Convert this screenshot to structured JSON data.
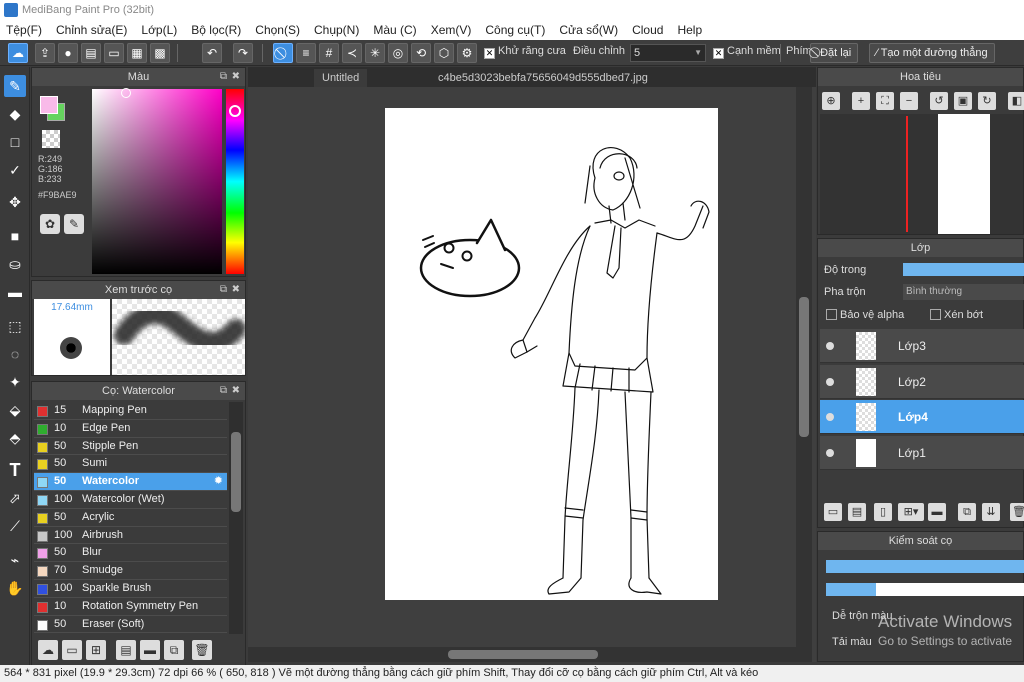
{
  "title": "MediBang Paint Pro (32bit)",
  "menu": [
    "Tệp(F)",
    "Chỉnh sửa(E)",
    "Lớp(L)",
    "Bộ lọc(R)",
    "Chọn(S)",
    "Chụp(N)",
    "Màu (C)",
    "Xem(V)",
    "Công cụ(T)",
    "Cửa sổ(W)",
    "Cloud",
    "Help"
  ],
  "toolbar": {
    "antialias_label": "Khử răng cưa",
    "adjust_label": "Điều chỉnh",
    "adjust_value": "5",
    "edge_label": "Cạnh mềm",
    "key_label": "Phím",
    "reset_label": "Đặt lại",
    "create_line_label": "Tạo một đường thẳng"
  },
  "color_panel": {
    "title": "Màu",
    "r": "R:249",
    "g": "G:186",
    "b": "B:233",
    "hex": "#F9BAE9",
    "fg_color": "#F9BAE9"
  },
  "brush_preview": {
    "title": "Xem trước cọ",
    "size": "17.64mm"
  },
  "brush_panel": {
    "title": "Cọ: Watercolor",
    "items": [
      {
        "size": "15",
        "name": "Mapping Pen",
        "color": "#e03030"
      },
      {
        "size": "10",
        "name": "Edge Pen",
        "color": "#2fae2f"
      },
      {
        "size": "50",
        "name": "Stipple Pen",
        "color": "#e8d020"
      },
      {
        "size": "50",
        "name": "Sumi",
        "color": "#e8d020"
      },
      {
        "size": "50",
        "name": "Watercolor",
        "color": "#8fd7f5",
        "selected": true
      },
      {
        "size": "100",
        "name": "Watercolor (Wet)",
        "color": "#8fd7f5"
      },
      {
        "size": "50",
        "name": "Acrylic",
        "color": "#e8d020"
      },
      {
        "size": "100",
        "name": "Airbrush",
        "color": "#c8c8c8"
      },
      {
        "size": "50",
        "name": "Blur",
        "color": "#f0a0e8"
      },
      {
        "size": "70",
        "name": "Smudge",
        "color": "#f6d8c0"
      },
      {
        "size": "100",
        "name": "Sparkle Brush",
        "color": "#3050e0"
      },
      {
        "size": "10",
        "name": "Rotation Symmetry Pen",
        "color": "#e03030"
      },
      {
        "size": "50",
        "name": "Eraser (Soft)",
        "color": "#ffffff"
      }
    ]
  },
  "tabs": [
    "Untitled",
    "c4be5d3023bebfa75656049d555dbed7.jpg"
  ],
  "navigator": {
    "title": "Hoa tiêu"
  },
  "layer_panel": {
    "title": "Lớp",
    "opacity_label": "Độ trong",
    "blend_label": "Pha trộn",
    "blend_value": "Bình thường",
    "protect_alpha": "Bảo vệ alpha",
    "clipping": "Xén bớt",
    "layers": [
      {
        "name": "Lớp3"
      },
      {
        "name": "Lớp2"
      },
      {
        "name": "Lớp4",
        "selected": true
      },
      {
        "name": "Lớp1"
      }
    ]
  },
  "brush_control": {
    "title": "Kiểm soát cọ",
    "mix_label": "Dễ trộn màu",
    "take_label": "Tải màu"
  },
  "watermark": {
    "line1": "Activate Windows",
    "line2": "Go to Settings to activate"
  },
  "status": "564 * 831 pixel   (19.9 * 29.3cm)   72 dpi   66 %   ( 650, 818 )   Vẽ một đường thẳng bằng cách giữ phím Shift, Thay đổi cỡ cọ bằng cách giữ phím Ctrl, Alt và kéo"
}
